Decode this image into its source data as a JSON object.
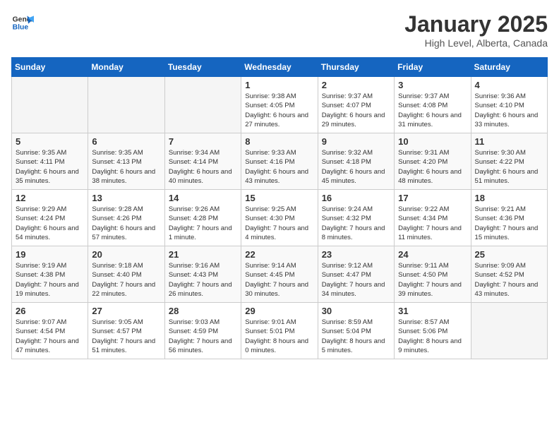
{
  "header": {
    "logo_line1": "General",
    "logo_line2": "Blue",
    "month_year": "January 2025",
    "location": "High Level, Alberta, Canada"
  },
  "weekdays": [
    "Sunday",
    "Monday",
    "Tuesday",
    "Wednesday",
    "Thursday",
    "Friday",
    "Saturday"
  ],
  "weeks": [
    [
      {
        "day": "",
        "info": ""
      },
      {
        "day": "",
        "info": ""
      },
      {
        "day": "",
        "info": ""
      },
      {
        "day": "1",
        "info": "Sunrise: 9:38 AM\nSunset: 4:05 PM\nDaylight: 6 hours and 27 minutes."
      },
      {
        "day": "2",
        "info": "Sunrise: 9:37 AM\nSunset: 4:07 PM\nDaylight: 6 hours and 29 minutes."
      },
      {
        "day": "3",
        "info": "Sunrise: 9:37 AM\nSunset: 4:08 PM\nDaylight: 6 hours and 31 minutes."
      },
      {
        "day": "4",
        "info": "Sunrise: 9:36 AM\nSunset: 4:10 PM\nDaylight: 6 hours and 33 minutes."
      }
    ],
    [
      {
        "day": "5",
        "info": "Sunrise: 9:35 AM\nSunset: 4:11 PM\nDaylight: 6 hours and 35 minutes."
      },
      {
        "day": "6",
        "info": "Sunrise: 9:35 AM\nSunset: 4:13 PM\nDaylight: 6 hours and 38 minutes."
      },
      {
        "day": "7",
        "info": "Sunrise: 9:34 AM\nSunset: 4:14 PM\nDaylight: 6 hours and 40 minutes."
      },
      {
        "day": "8",
        "info": "Sunrise: 9:33 AM\nSunset: 4:16 PM\nDaylight: 6 hours and 43 minutes."
      },
      {
        "day": "9",
        "info": "Sunrise: 9:32 AM\nSunset: 4:18 PM\nDaylight: 6 hours and 45 minutes."
      },
      {
        "day": "10",
        "info": "Sunrise: 9:31 AM\nSunset: 4:20 PM\nDaylight: 6 hours and 48 minutes."
      },
      {
        "day": "11",
        "info": "Sunrise: 9:30 AM\nSunset: 4:22 PM\nDaylight: 6 hours and 51 minutes."
      }
    ],
    [
      {
        "day": "12",
        "info": "Sunrise: 9:29 AM\nSunset: 4:24 PM\nDaylight: 6 hours and 54 minutes."
      },
      {
        "day": "13",
        "info": "Sunrise: 9:28 AM\nSunset: 4:26 PM\nDaylight: 6 hours and 57 minutes."
      },
      {
        "day": "14",
        "info": "Sunrise: 9:26 AM\nSunset: 4:28 PM\nDaylight: 7 hours and 1 minute."
      },
      {
        "day": "15",
        "info": "Sunrise: 9:25 AM\nSunset: 4:30 PM\nDaylight: 7 hours and 4 minutes."
      },
      {
        "day": "16",
        "info": "Sunrise: 9:24 AM\nSunset: 4:32 PM\nDaylight: 7 hours and 8 minutes."
      },
      {
        "day": "17",
        "info": "Sunrise: 9:22 AM\nSunset: 4:34 PM\nDaylight: 7 hours and 11 minutes."
      },
      {
        "day": "18",
        "info": "Sunrise: 9:21 AM\nSunset: 4:36 PM\nDaylight: 7 hours and 15 minutes."
      }
    ],
    [
      {
        "day": "19",
        "info": "Sunrise: 9:19 AM\nSunset: 4:38 PM\nDaylight: 7 hours and 19 minutes."
      },
      {
        "day": "20",
        "info": "Sunrise: 9:18 AM\nSunset: 4:40 PM\nDaylight: 7 hours and 22 minutes."
      },
      {
        "day": "21",
        "info": "Sunrise: 9:16 AM\nSunset: 4:43 PM\nDaylight: 7 hours and 26 minutes."
      },
      {
        "day": "22",
        "info": "Sunrise: 9:14 AM\nSunset: 4:45 PM\nDaylight: 7 hours and 30 minutes."
      },
      {
        "day": "23",
        "info": "Sunrise: 9:12 AM\nSunset: 4:47 PM\nDaylight: 7 hours and 34 minutes."
      },
      {
        "day": "24",
        "info": "Sunrise: 9:11 AM\nSunset: 4:50 PM\nDaylight: 7 hours and 39 minutes."
      },
      {
        "day": "25",
        "info": "Sunrise: 9:09 AM\nSunset: 4:52 PM\nDaylight: 7 hours and 43 minutes."
      }
    ],
    [
      {
        "day": "26",
        "info": "Sunrise: 9:07 AM\nSunset: 4:54 PM\nDaylight: 7 hours and 47 minutes."
      },
      {
        "day": "27",
        "info": "Sunrise: 9:05 AM\nSunset: 4:57 PM\nDaylight: 7 hours and 51 minutes."
      },
      {
        "day": "28",
        "info": "Sunrise: 9:03 AM\nSunset: 4:59 PM\nDaylight: 7 hours and 56 minutes."
      },
      {
        "day": "29",
        "info": "Sunrise: 9:01 AM\nSunset: 5:01 PM\nDaylight: 8 hours and 0 minutes."
      },
      {
        "day": "30",
        "info": "Sunrise: 8:59 AM\nSunset: 5:04 PM\nDaylight: 8 hours and 5 minutes."
      },
      {
        "day": "31",
        "info": "Sunrise: 8:57 AM\nSunset: 5:06 PM\nDaylight: 8 hours and 9 minutes."
      },
      {
        "day": "",
        "info": ""
      }
    ]
  ]
}
